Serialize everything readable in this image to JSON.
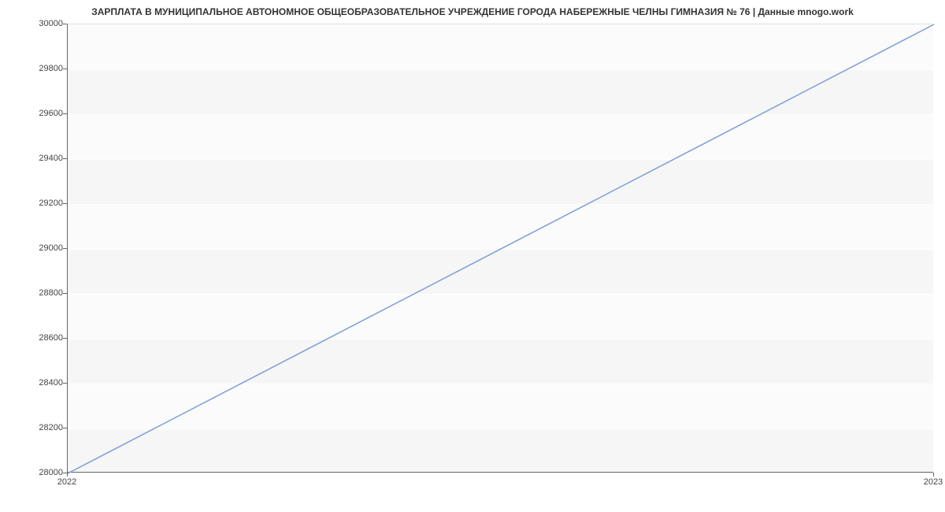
{
  "chart_data": {
    "type": "line",
    "title": "ЗАРПЛАТА В МУНИЦИПАЛЬНОЕ АВТОНОМНОЕ ОБЩЕОБРАЗОВАТЕЛЬНОЕ УЧРЕЖДЕНИЕ ГОРОДА НАБЕРЕЖНЫЕ ЧЕЛНЫ ГИМНАЗИЯ № 76 | Данные mnogo.work",
    "x": [
      2022,
      2023
    ],
    "values": [
      28000,
      30000
    ],
    "x_tick_labels": [
      "2022",
      "2023"
    ],
    "y_ticks": [
      28000,
      28200,
      28400,
      28600,
      28800,
      29000,
      29200,
      29400,
      29600,
      29800,
      30000
    ],
    "ylim": [
      28000,
      30000
    ],
    "xlim": [
      2022,
      2023
    ],
    "line_color": "#7c9fd8",
    "xlabel": "",
    "ylabel": ""
  }
}
